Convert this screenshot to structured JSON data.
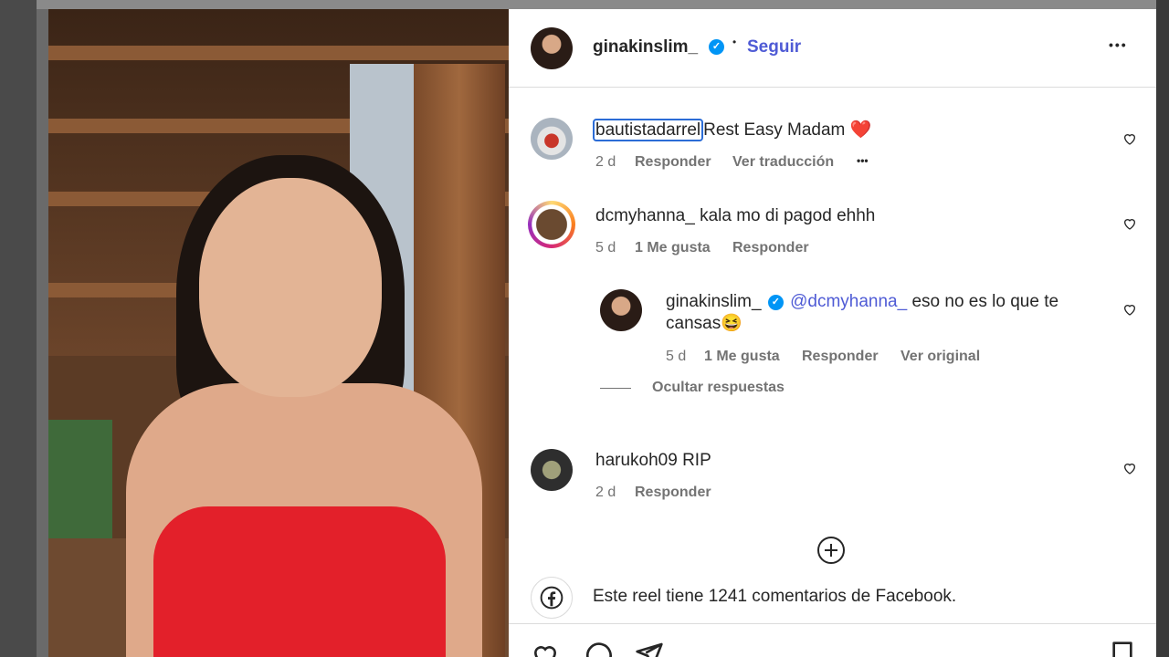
{
  "post": {
    "author": "ginakinslim_",
    "follow_label": "Seguir",
    "separator": "•",
    "more": "•••"
  },
  "comments": [
    {
      "user": "bautistadarrel",
      "text": "Rest Easy Madam ❤️",
      "time": "2 d",
      "reply": "Responder",
      "translate": "Ver traducción",
      "more": "•••"
    },
    {
      "user": "dcmyhanna_",
      "text": "kala mo di pagod ehhh",
      "time": "5 d",
      "likes": "1 Me gusta",
      "reply": "Responder"
    },
    {
      "user": "harukoh09",
      "text": "RIP",
      "time": "2 d",
      "reply": "Responder"
    }
  ],
  "reply": {
    "user": "ginakinslim_",
    "mention": "@dcmyhanna_",
    "text_line1": "eso no es lo que te",
    "text_line2": "cansas😆",
    "time": "5 d",
    "likes": "1 Me gusta",
    "reply": "Responder",
    "original": "Ver original"
  },
  "hide_replies": "Ocultar respuestas",
  "facebook_note": "Este reel tiene 1241 comentarios de Facebook.",
  "colors": {
    "link": "#4f5bd5",
    "verified": "#0095f6",
    "heart": "#e8262d"
  },
  "icons": [
    "heart-icon",
    "comment-icon",
    "share-icon",
    "bookmark-icon",
    "add-circle-icon",
    "facebook-icon",
    "verified-badge-icon"
  ]
}
